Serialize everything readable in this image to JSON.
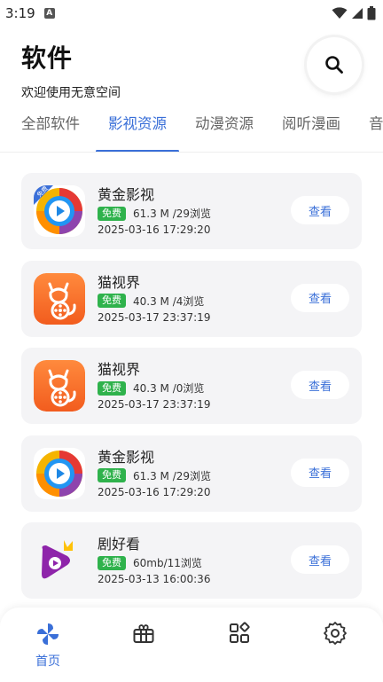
{
  "status_bar": {
    "time": "3:19",
    "notification_letter": "A"
  },
  "header": {
    "title": "软件",
    "subtitle": "欢迎使用无意空间"
  },
  "tabs": [
    {
      "label": "全部软件",
      "active": false
    },
    {
      "label": "影视资源",
      "active": true
    },
    {
      "label": "动漫资源",
      "active": false
    },
    {
      "label": "阅听漫画",
      "active": false
    },
    {
      "label": "音",
      "active": false
    }
  ],
  "apps": [
    {
      "name": "黄金影视",
      "badge": "免费",
      "meta": "61.3 M /29浏览",
      "date": "2025-03-16 17:29:20",
      "icon": "golden-video-icon",
      "corner_ribbon": "免费",
      "action": "查看"
    },
    {
      "name": "猫视界",
      "badge": "免费",
      "meta": "40.3 M /4浏览",
      "date": "2025-03-17 23:37:19",
      "icon": "cat-film-icon",
      "action": "查看"
    },
    {
      "name": "猫视界",
      "badge": "免费",
      "meta": "40.3 M /0浏览",
      "date": "2025-03-17 23:37:19",
      "icon": "cat-film-icon",
      "action": "查看"
    },
    {
      "name": "黄金影视",
      "badge": "免费",
      "meta": "61.3 M /29浏览",
      "date": "2025-03-16 17:29:20",
      "icon": "golden-video-icon",
      "action": "查看"
    },
    {
      "name": "剧好看",
      "badge": "免费",
      "meta": "60mb/11浏览",
      "date": "2025-03-13 16:00:36",
      "icon": "play-crown-icon",
      "action": "查看"
    }
  ],
  "bottom_nav": [
    {
      "label": "首页",
      "icon": "pinwheel-icon",
      "active": true
    },
    {
      "label": "",
      "icon": "gift-box-icon",
      "active": false
    },
    {
      "label": "",
      "icon": "apps-grid-icon",
      "active": false
    },
    {
      "label": "",
      "icon": "gear-icon",
      "active": false
    }
  ],
  "colors": {
    "accent": "#3a6fd8",
    "free_badge": "#2fb24c",
    "card_bg": "#f4f4f6"
  }
}
